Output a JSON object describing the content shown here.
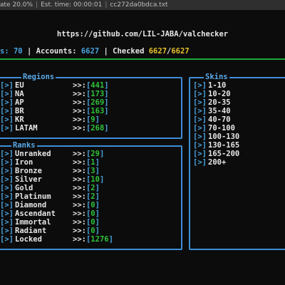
{
  "titlebar": {
    "segments": [
      "ate 20.0%",
      "Est. time: 00:00:01",
      "cc272da0bdca.txt"
    ]
  },
  "header": {
    "url": "https://github.com/LIL-JABA/valchecker"
  },
  "stats": {
    "prefix": "s:",
    "threads_value": "70",
    "accounts_label": "Accounts:",
    "accounts_value": "6627",
    "checked_label": "Checked",
    "checked_value": "6627",
    "checked_total": "6627"
  },
  "regions": {
    "title": "Regions",
    "items": [
      {
        "label": "EU",
        "value": "441"
      },
      {
        "label": "NA",
        "value": "173"
      },
      {
        "label": "AP",
        "value": "269"
      },
      {
        "label": "BR",
        "value": "163"
      },
      {
        "label": "KR",
        "value": "9"
      },
      {
        "label": "LATAM",
        "value": "268"
      }
    ]
  },
  "ranks": {
    "title": "Ranks",
    "items": [
      {
        "label": "Unranked",
        "value": "29"
      },
      {
        "label": "Iron",
        "value": "1"
      },
      {
        "label": "Bronze",
        "value": "3"
      },
      {
        "label": "Silver",
        "value": "10"
      },
      {
        "label": "Gold",
        "value": "2"
      },
      {
        "label": "Platinum",
        "value": "2"
      },
      {
        "label": "Diamond",
        "value": "0"
      },
      {
        "label": "Ascendant",
        "value": "0"
      },
      {
        "label": "Immortal",
        "value": "0"
      },
      {
        "label": "Radiant",
        "value": "0"
      },
      {
        "label": "Locked",
        "value": "1276"
      }
    ]
  },
  "skins": {
    "title": "Skins",
    "items": [
      "1-10",
      "10-20",
      "20-35",
      "35-40",
      "40-70",
      "70-100",
      "100-130",
      "130-165",
      "165-200",
      "200+"
    ]
  },
  "glyphs": {
    "mark": "[>]",
    "arrows": ">>:",
    "open": "[",
    "close": "]"
  }
}
